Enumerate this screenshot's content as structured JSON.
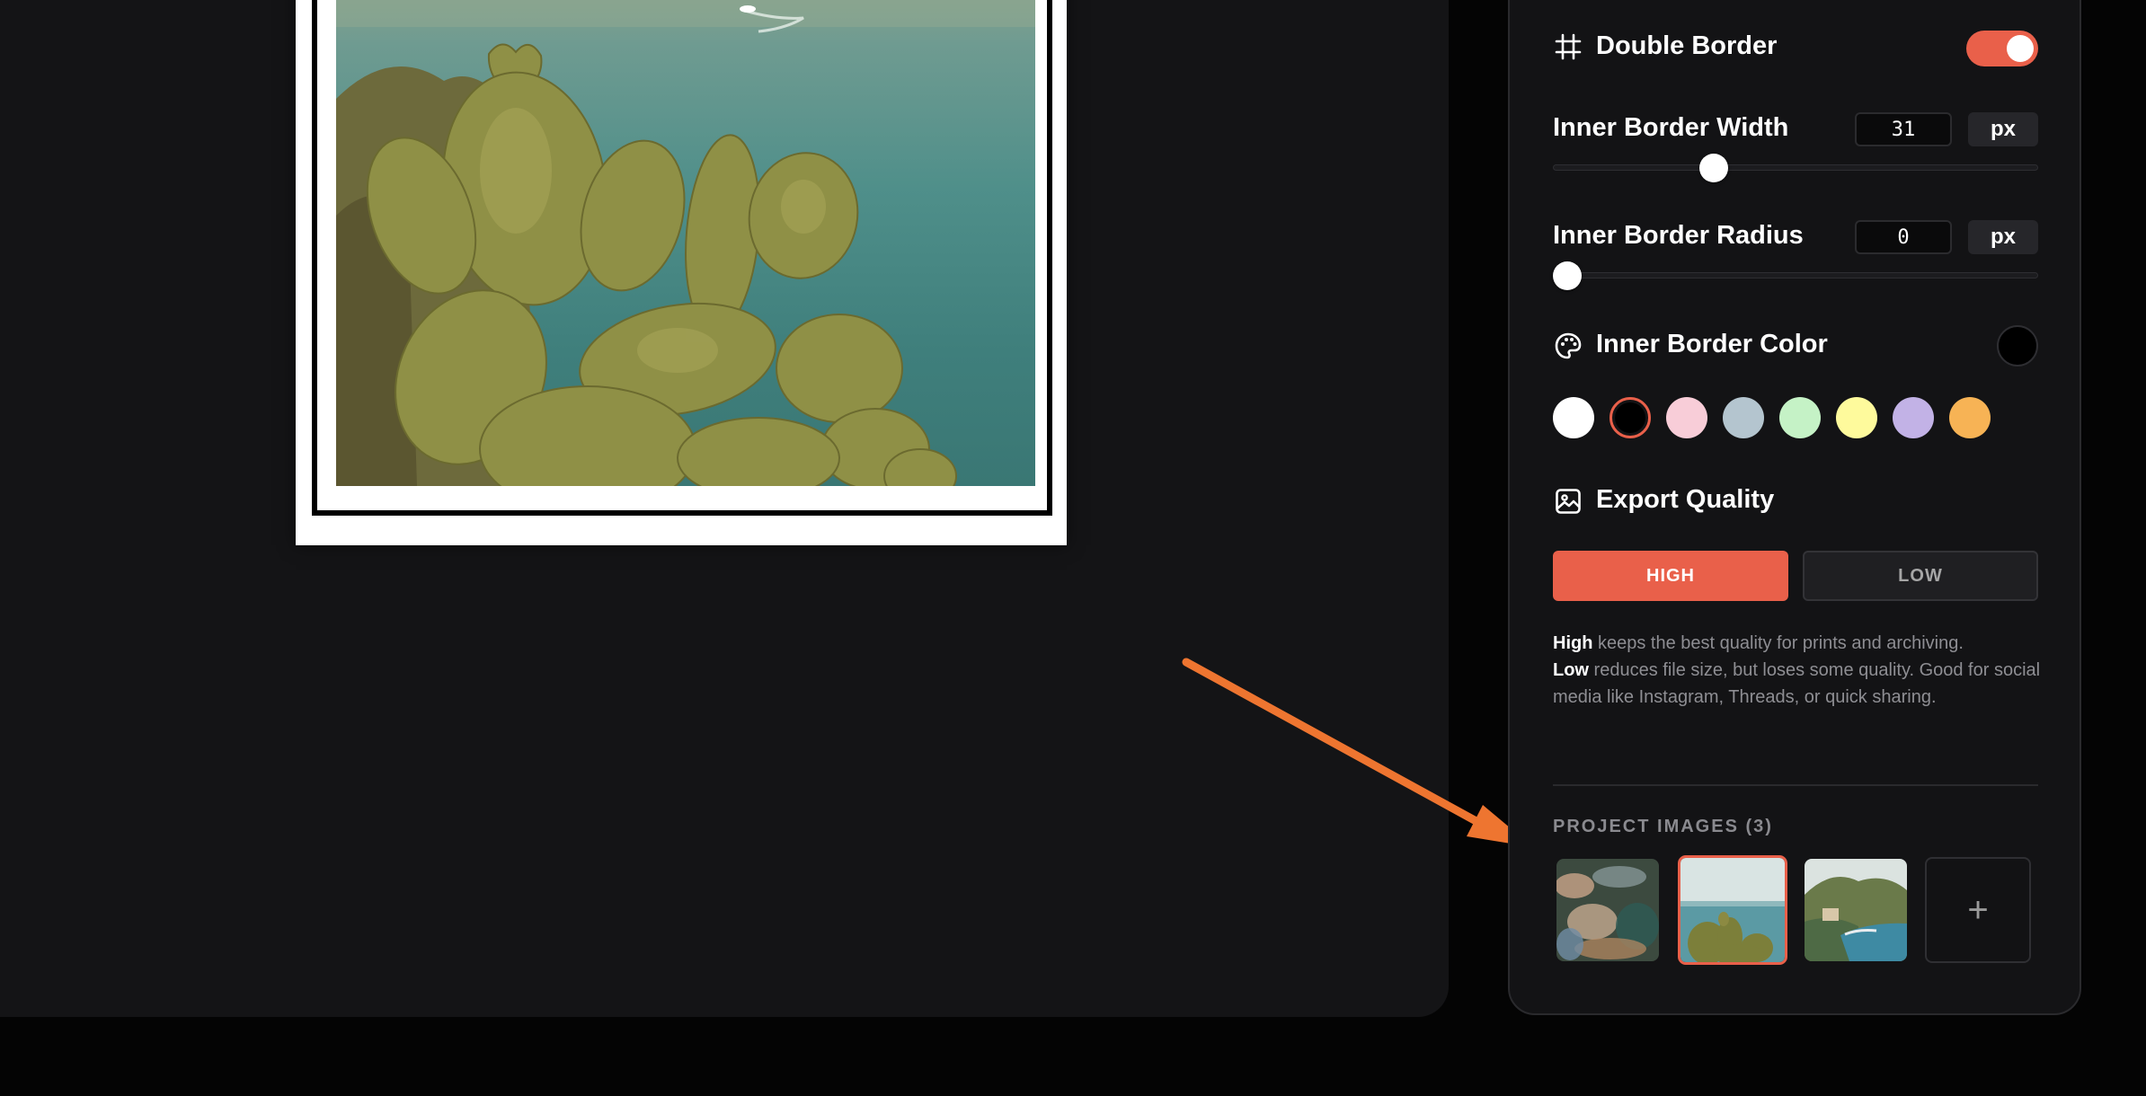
{
  "panel": {
    "double_border": {
      "label": "Double Border",
      "enabled": true,
      "icon": "hash-frame-icon"
    },
    "inner_border_width": {
      "label": "Inner Border Width",
      "value": "31",
      "unit": "px",
      "slider_fraction": 0.32
    },
    "inner_border_radius": {
      "label": "Inner Border Radius",
      "value": "0",
      "unit": "px",
      "slider_fraction": 0.0
    },
    "inner_border_color": {
      "label": "Inner Border Color",
      "icon": "palette-icon",
      "current": "#000000",
      "swatches": [
        "#ffffff",
        "#000000",
        "#f8cdd8",
        "#b4c5cf",
        "#c5f2c6",
        "#fefa9c",
        "#c2b2e6",
        "#f7b355"
      ],
      "selected_index": 1
    },
    "export_quality": {
      "label": "Export Quality",
      "icon": "image-icon",
      "high_label": "HIGH",
      "low_label": "LOW",
      "selected": "HIGH",
      "desc_high_strong": "High",
      "desc_high_text": " keeps the best quality for prints and archiving.",
      "desc_low_strong": "Low",
      "desc_low_text": " reduces file size, but loses some quality. Good for social media like Instagram, Threads, or quick sharing."
    },
    "project_images": {
      "title": "PROJECT IMAGES (3)",
      "selected_index": 1,
      "add_label": "+"
    }
  },
  "colors": {
    "accent": "#e9604a",
    "panel_bg": "#131315",
    "canvas_bg": "#141416",
    "arrow": "#ee7530"
  }
}
